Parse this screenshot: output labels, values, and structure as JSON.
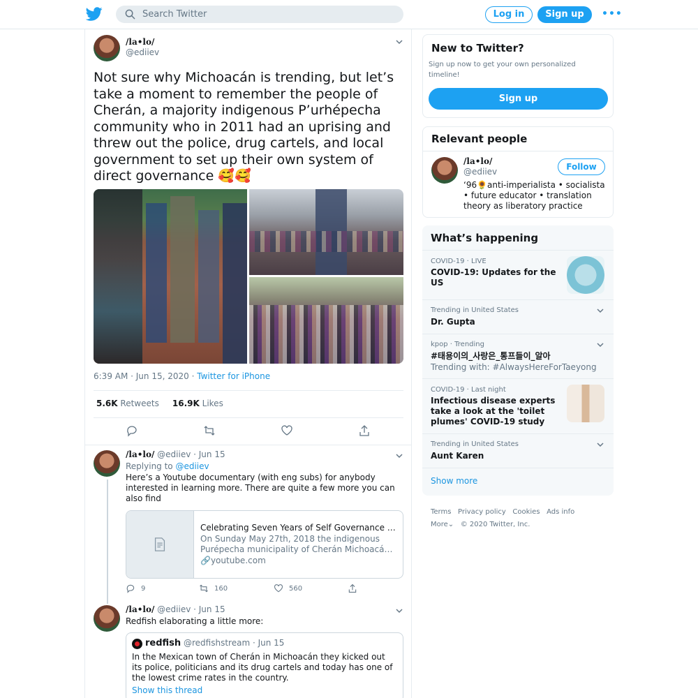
{
  "header": {
    "search_placeholder": "Search Twitter",
    "login_label": "Log in",
    "signup_label": "Sign up",
    "more_label": "•••"
  },
  "tweet": {
    "author_name": "/la•lo/",
    "author_handle": "@ediiev",
    "text": "Not sure why Michoacán is trending, but let’s take a moment to remember the people of Cherán, a majority indigenous P’urhépecha community who in 2011 had an uprising and threw out the police, drug cartels, and local government to set up their own system of direct governance 🥰🥰",
    "time": "6:39 AM · Jun 15, 2020 · ",
    "source": "Twitter for iPhone",
    "retweets_count": "5.6K",
    "retweets_label": "Retweets",
    "likes_count": "16.9K",
    "likes_label": "Likes"
  },
  "replies": [
    {
      "author_name": "/la•lo/",
      "author_meta": "@ediiev · Jun 15",
      "replying_prefix": "Replying to ",
      "replying_handle": "@ediiev",
      "text": "Here’s a Youtube documentary (with eng subs) for anybody interested in learning more. There are quite a few more you can also find",
      "card": {
        "title": "Celebrating Seven Years of Self Governance i...",
        "desc_line1": "On Sunday May 27th, 2018 the indigenous",
        "desc_line2": "Purépecha municipality of Cherán Michoacán ...",
        "link": "youtube.com"
      },
      "reply_count": "9",
      "retweet_count": "160",
      "like_count": "560"
    },
    {
      "author_name": "/la•lo/",
      "author_meta": "@ediiev · Jun 15",
      "text": "Redfish elaborating a little more:",
      "quote": {
        "name": "redfish",
        "meta": "@redfishstream · Jun 15",
        "text": "In the Mexican town of Cherán in Michoacán they kicked out its police, politicians and its drug cartels and today has one of the lowest crime rates in the country.",
        "show_thread": "Show this thread"
      }
    }
  ],
  "sidebar": {
    "new_title": "New to Twitter?",
    "new_desc": "Sign up now to get your own personalized timeline!",
    "new_signup": "Sign up",
    "relevant_title": "Relevant people",
    "person_name": "/la•lo/",
    "person_handle": "@ediiev",
    "follow_label": "Follow",
    "person_bio": "‘96🌻anti-imperialista • socialista • future educator • translation theory as liberatory practice",
    "happening_title": "What’s happening",
    "trends": [
      {
        "context": "COVID-19 · LIVE",
        "name": "COVID-19: Updates for the US"
      },
      {
        "context": "Trending in United States",
        "name": "Dr. Gupta"
      },
      {
        "context": "kpop · Trending",
        "name": "#태용이의_사랑은_통프들이_알아",
        "extra": "Trending with: #AlwaysHereForTaeyong"
      },
      {
        "context": "COVID-19 · Last night",
        "name": "Infectious disease experts take a look at the 'toilet plumes' COVID-19 study"
      },
      {
        "context": "Trending in United States",
        "name": "Aunt Karen"
      }
    ],
    "show_more": "Show more"
  },
  "footer": {
    "links": [
      "Terms",
      "Privacy policy",
      "Cookies",
      "Ads info"
    ],
    "more": "More",
    "copyright": "© 2020 Twitter, Inc."
  }
}
